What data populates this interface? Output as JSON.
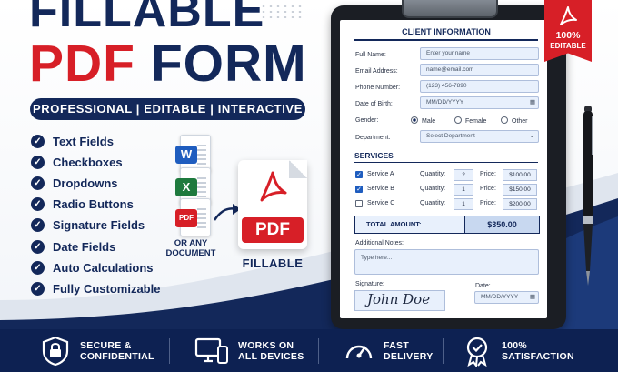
{
  "hero": {
    "title_line1": "FILLABLE",
    "title_pdf": "PDF",
    "title_form": "FORM",
    "tagline": "PROFESSIONAL | EDITABLE | INTERACTIVE"
  },
  "features": [
    "Text Fields",
    "Checkboxes",
    "Dropdowns",
    "Radio Buttons",
    "Signature Fields",
    "Date Fields",
    "Auto Calculations",
    "Fully Customizable"
  ],
  "conversion": {
    "source_badges": [
      "W",
      "X",
      "PDF"
    ],
    "source_caption_1": "OR ANY",
    "source_caption_2": "DOCUMENT",
    "target_label": "PDF",
    "target_caption": "FILLABLE"
  },
  "ribbon": {
    "percent": "100%",
    "label": "EDITABLE"
  },
  "form": {
    "title": "CLIENT INFORMATION",
    "full_name_label": "Full Name:",
    "full_name_placeholder": "Enter your name",
    "email_label": "Email Address:",
    "email_placeholder": "name@email.com",
    "phone_label": "Phone Number:",
    "phone_placeholder": "(123) 456-7890",
    "dob_label": "Date of Birth:",
    "dob_placeholder": "MM/DD/YYYY",
    "gender_label": "Gender:",
    "gender_options": [
      "Male",
      "Female",
      "Other"
    ],
    "gender_selected": "Male",
    "department_label": "Department:",
    "department_placeholder": "Select Department",
    "services_title": "SERVICES",
    "services": [
      {
        "name": "Service A",
        "checked": true,
        "quantity_label": "Quantity:",
        "quantity": "2",
        "price_label": "Price:",
        "price": "$100.00"
      },
      {
        "name": "Service B",
        "checked": true,
        "quantity_label": "Quantity:",
        "quantity": "1",
        "price_label": "Price:",
        "price": "$150.00"
      },
      {
        "name": "Service C",
        "checked": false,
        "quantity_label": "Quantity:",
        "quantity": "1",
        "price_label": "Price:",
        "price": "$200.00"
      }
    ],
    "total_label": "TOTAL AMOUNT:",
    "total_value": "$350.00",
    "notes_label": "Additional Notes:",
    "notes_placeholder": "Type here...",
    "signature_label": "Signature:",
    "signature_value": "John Doe",
    "date_label": "Date:",
    "date_placeholder": "MM/DD/YYYY"
  },
  "footer": [
    {
      "icon": "lock-shield-icon",
      "line1": "SECURE &",
      "line2": "CONFIDENTIAL"
    },
    {
      "icon": "devices-icon",
      "line1": "WORKS ON",
      "line2": "ALL DEVICES"
    },
    {
      "icon": "speedometer-icon",
      "line1": "FAST",
      "line2": "DELIVERY"
    },
    {
      "icon": "award-badge-icon",
      "line1": "100%",
      "line2": "SATISFACTION"
    }
  ],
  "colors": {
    "navy": "#13285a",
    "red": "#d71f27",
    "field_fill": "#e8f0fc",
    "footer_bg": "#0d2152"
  }
}
